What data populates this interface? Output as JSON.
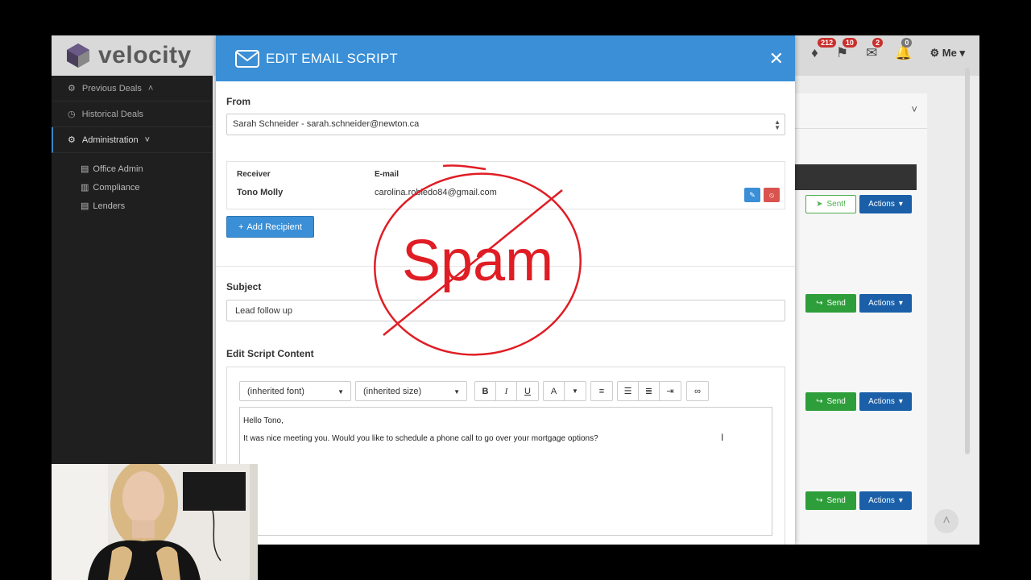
{
  "app": {
    "logo_text": "velocity",
    "header": {
      "icons": [
        {
          "name": "thumbs-down-icon",
          "badge": "212"
        },
        {
          "name": "flag-icon",
          "badge": "10"
        },
        {
          "name": "envelope-icon",
          "badge": "2"
        },
        {
          "name": "bell-icon",
          "badge": "0"
        }
      ],
      "user_label": "Me"
    },
    "accent": "#3a8fd6"
  },
  "sidebar": {
    "items": [
      {
        "label": "Previous Deals",
        "icon": "gear-icon"
      },
      {
        "label": "Historical Deals",
        "icon": "clock-icon"
      },
      {
        "label": "Administration",
        "icon": "gear-icon"
      }
    ],
    "sub_items": [
      {
        "label": "Office Admin",
        "icon": "building-icon"
      },
      {
        "label": "Compliance",
        "icon": "trash-icon"
      },
      {
        "label": "Lenders",
        "icon": "building-icon"
      }
    ]
  },
  "right_panel": {
    "rows": [
      {
        "status_label": "Sent!",
        "actions_label": "Actions"
      },
      {
        "status_label": "Send",
        "actions_label": "Actions"
      },
      {
        "status_label": "Send",
        "actions_label": "Actions"
      },
      {
        "status_label": "Send",
        "actions_label": "Actions"
      }
    ]
  },
  "modal": {
    "title": "EDIT EMAIL SCRIPT",
    "from_label": "From",
    "from_value": "Sarah Schneider - sarah.schneider@newton.ca",
    "receiver_header": "Receiver",
    "email_header": "E-mail",
    "receiver_name": "Tono Molly",
    "receiver_email": "carolina.robledo84@gmail.com",
    "add_recipient_label": "Add Recipient",
    "subject_label": "Subject",
    "subject_value": "Lead follow up",
    "content_label": "Edit Script Content",
    "font_select": "(inherited font)",
    "size_select": "(inherited size)",
    "toolbar": {
      "bold": "B",
      "italic": "I",
      "underline": "U",
      "color": "A"
    },
    "body_lines": [
      "Hello Tono,",
      "It was nice meeting you. Would you like to schedule a phone call to go over your mortgage options?"
    ]
  },
  "stamp": {
    "text": "Spam",
    "color": "#e01d24"
  }
}
